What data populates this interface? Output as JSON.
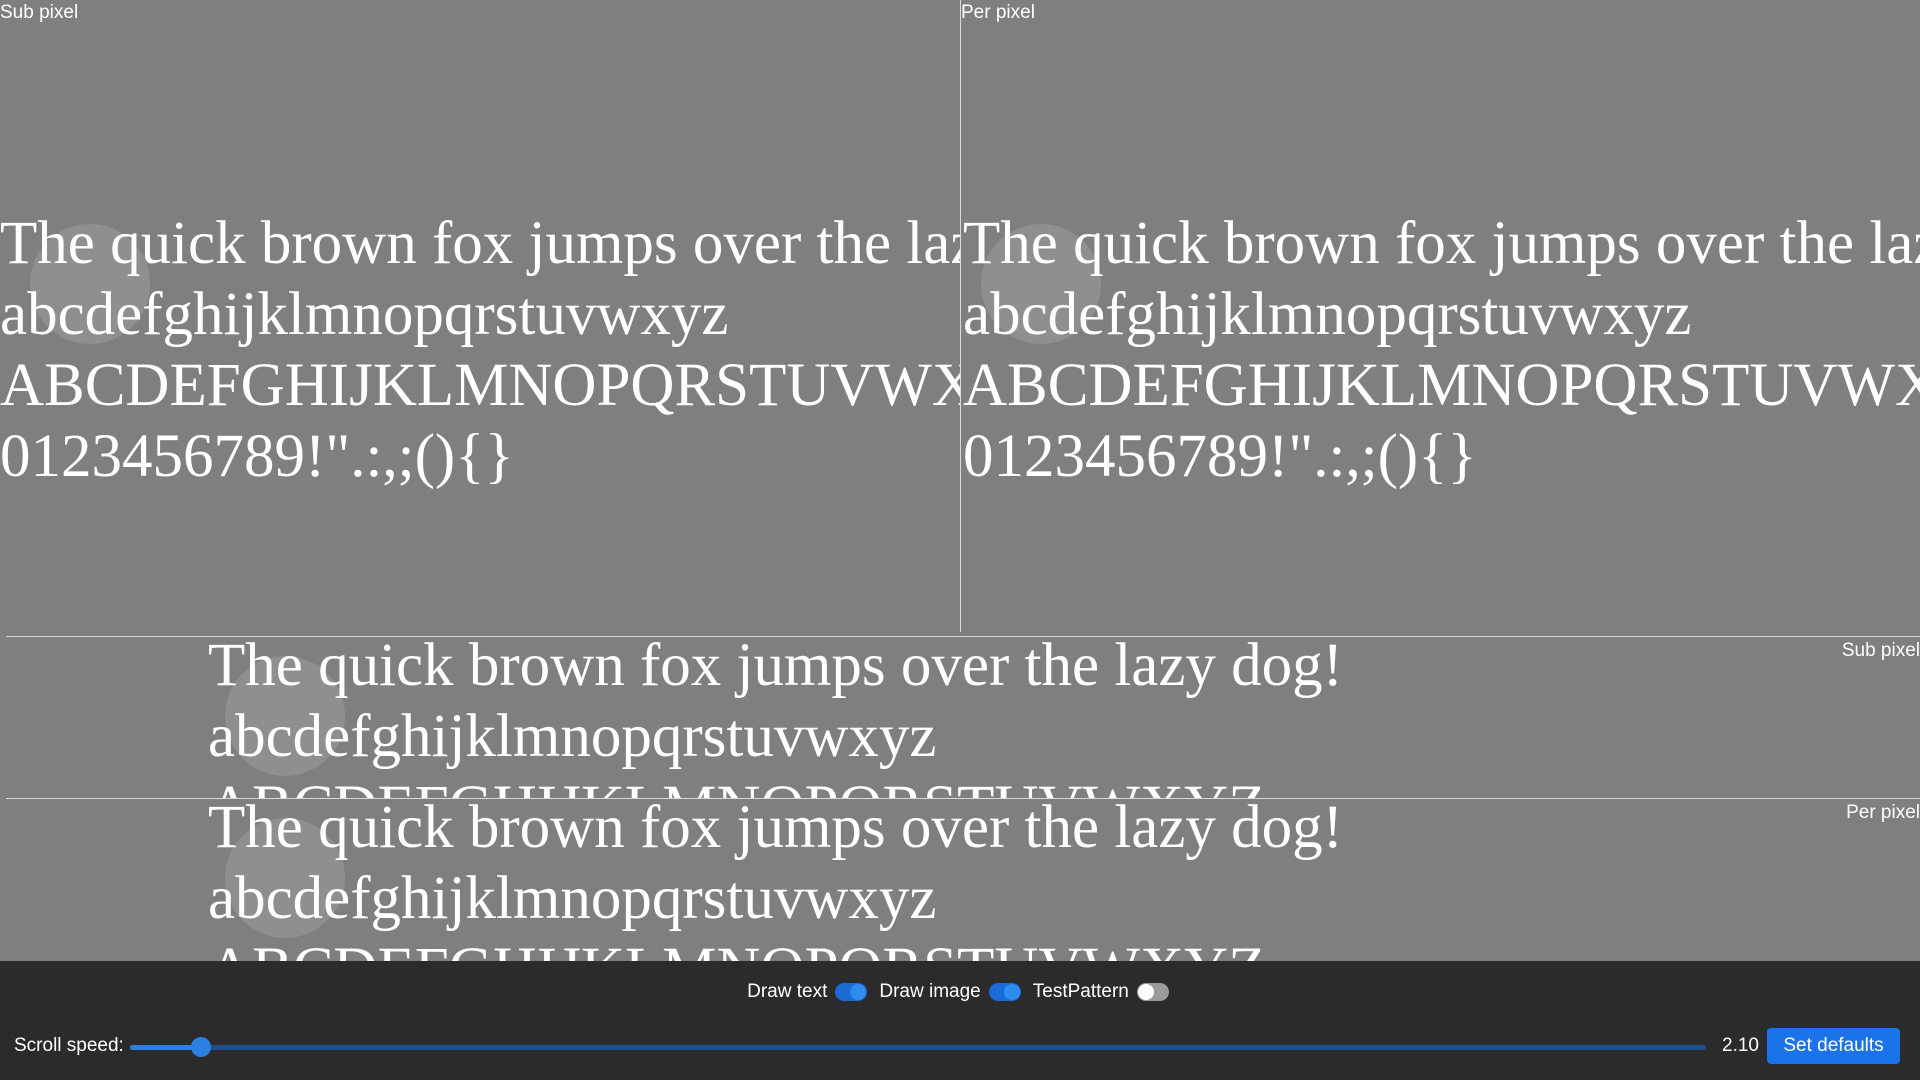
{
  "panes": {
    "top_left_label": "Sub pixel",
    "top_right_label": "Per pixel",
    "strip1_label": "Sub pixel",
    "strip2_label": "Per pixel"
  },
  "sample_lines": [
    "The quick brown fox jumps over the lazy dog!",
    "abcdefghijklmnopqrstuvwxyz",
    "ABCDEFGHIJKLMNOPQRSTUVWXYZ",
    "0123456789!\".:,;(){}"
  ],
  "controls": {
    "draw_text_label": "Draw text",
    "draw_text_on": true,
    "draw_image_label": "Draw image",
    "draw_image_on": true,
    "test_pattern_label": "TestPattern",
    "test_pattern_on": false,
    "scroll_speed_label": "Scroll speed:",
    "scroll_speed_fraction": 0.045,
    "scroll_speed_value": "2.10",
    "set_defaults_label": "Set defaults"
  },
  "colors": {
    "background": "#7f7f7f",
    "control_bar": "#2b2b2b",
    "accent": "#1a73e8"
  }
}
